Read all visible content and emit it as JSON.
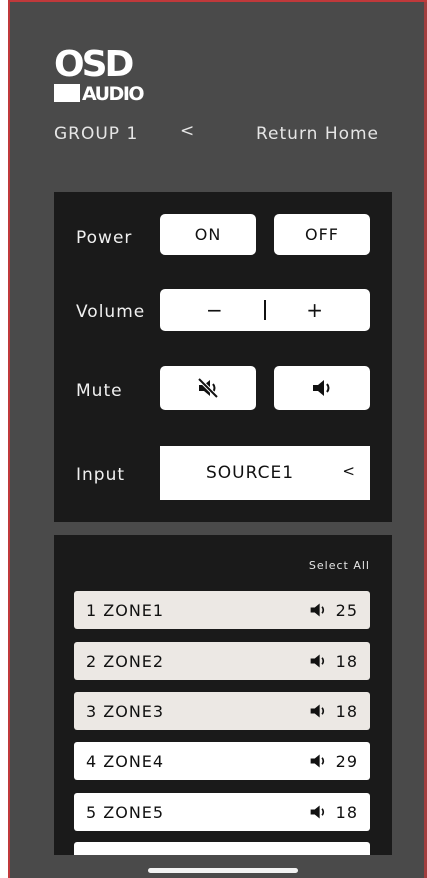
{
  "brand": {
    "logo_top": "OSD",
    "logo_bottom": "AUDIO"
  },
  "header": {
    "group_label": "GROUP 1",
    "back_chevron": "<",
    "return_home": "Return Home"
  },
  "controls": {
    "power": {
      "label": "Power",
      "on": "ON",
      "off": "OFF"
    },
    "volume": {
      "label": "Volume",
      "minus": "−",
      "plus": "+"
    },
    "mute": {
      "label": "Mute",
      "mute_icon": "speaker-muted-icon",
      "unmute_icon": "speaker-icon"
    },
    "input": {
      "label": "Input",
      "value": "SOURCE1",
      "caret": "<"
    }
  },
  "zones": {
    "select_all": "Select All",
    "items": [
      {
        "name": "1 ZONE1",
        "volume": "25",
        "selected": true
      },
      {
        "name": "2 ZONE2",
        "volume": "18",
        "selected": true
      },
      {
        "name": "3 ZONE3",
        "volume": "18",
        "selected": true
      },
      {
        "name": "4 ZONE4",
        "volume": "29",
        "selected": false
      },
      {
        "name": "5 ZONE5",
        "volume": "18",
        "selected": false
      }
    ]
  },
  "colors": {
    "background": "#4a4a4a",
    "panel": "#1a1a1a",
    "button": "#ffffff",
    "zone_selected": "#ece8e4",
    "frame_accent": "#c0393b"
  }
}
